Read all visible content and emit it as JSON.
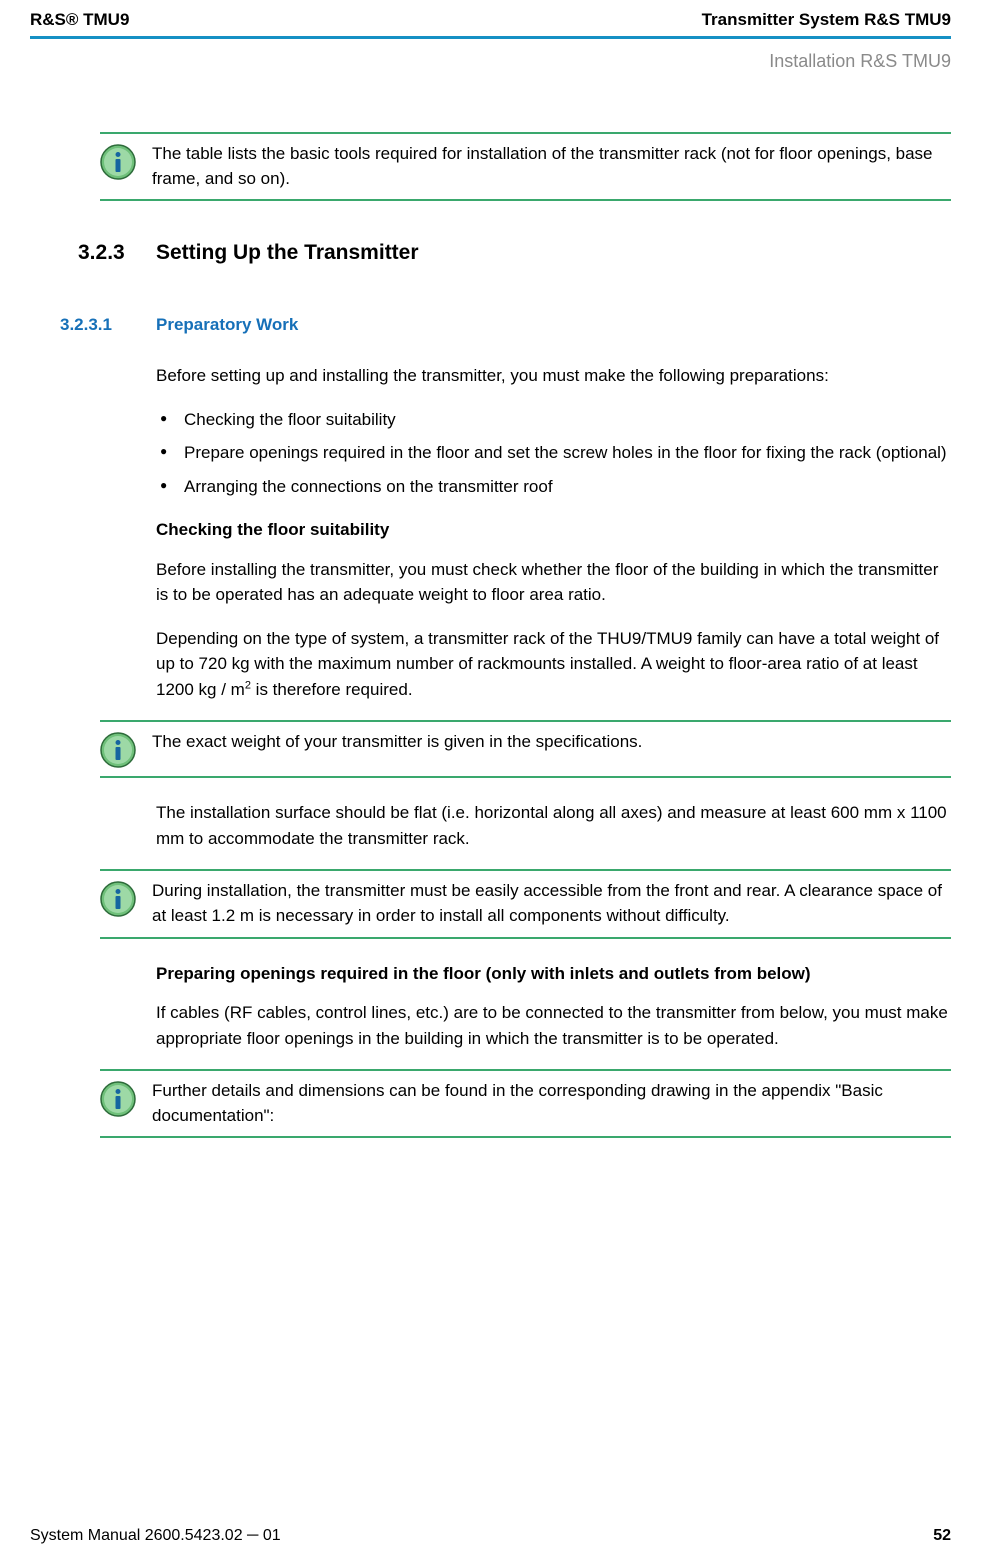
{
  "header": {
    "left": "R&S® TMU9",
    "right": "Transmitter System R&S TMU9"
  },
  "section_tag": "Installation R&S TMU9",
  "info1": "The table lists the basic tools required for installation of the transmitter rack (not for floor openings, base frame, and so on).",
  "heading": {
    "num": "3.2.3",
    "title": "Setting Up the Transmitter"
  },
  "subheading": {
    "num": "3.2.3.1",
    "title": "Preparatory Work"
  },
  "p1": "Before setting up and installing the transmitter, you must make the following preparations:",
  "bullets": [
    "Checking the floor suitability",
    "Prepare openings required in the floor and set the screw holes in the floor for fixing the rack (optional)",
    "Arranging the connections on the transmitter roof"
  ],
  "h_floor": "Checking the floor suitability",
  "p_floor1": "Before installing the transmitter, you must check whether the floor of the building in which the transmitter is to be operated has an adequate weight to floor area ratio.",
  "p_floor2_a": "Depending on the type of system, a transmitter rack of the THU9/TMU9 family can have a total weight of up to 720 kg with the maximum number of rackmounts installed. A weight to floor-area ratio of at least 1200 kg / m",
  "p_floor2_b": " is therefore required.",
  "info2": "The exact weight of your transmitter is given in the specifications.",
  "p_surface": "The installation surface should be flat (i.e. horizontal along all axes) and measure at least 600 mm x 1100 mm to accommodate the transmitter rack.",
  "info3": "During installation, the transmitter must be easily accessible from the front and rear. A clearance space of at least 1.2 m is necessary in order to install all components without difficulty.",
  "h_openings": "Preparing openings required in the floor (only with inlets and outlets from below)",
  "p_openings": "If cables (RF cables, control lines, etc.) are to be connected to the transmitter from below, you must make appropriate floor openings in the building in which the transmitter is to be operated.",
  "info4": "Further details and dimensions can be found in the corresponding drawing in the appendix \"Basic documentation\":",
  "footer": {
    "left": "System Manual 2600.5423.02 ─ 01",
    "right": "52"
  }
}
